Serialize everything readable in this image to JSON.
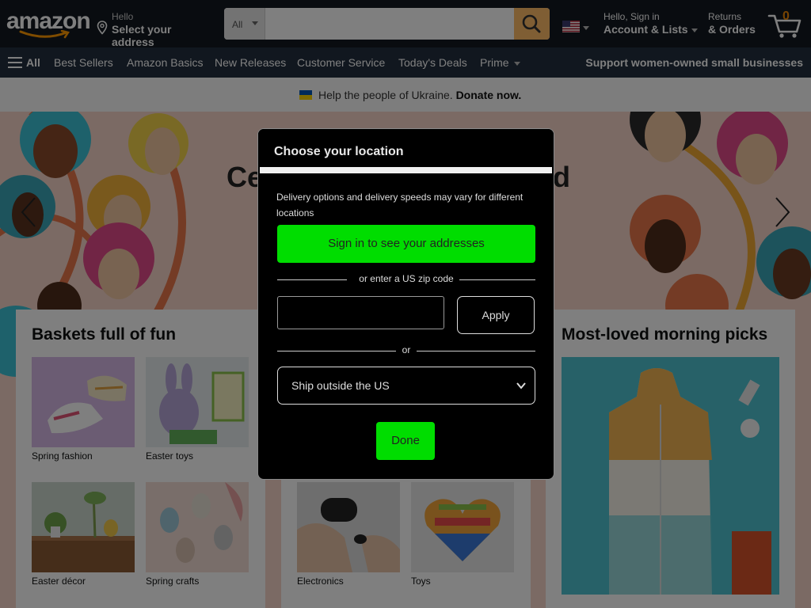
{
  "header": {
    "logo_text": "amazon",
    "address_line1": "Hello",
    "address_line2": "Select your address",
    "search_category": "All",
    "search_placeholder": "",
    "account_line1": "Hello, Sign in",
    "account_line2": "Account & Lists",
    "returns_line1": "Returns",
    "returns_line2": "& Orders",
    "cart_count": "0"
  },
  "subnav": {
    "all_label": "All",
    "items": [
      "Best Sellers",
      "Amazon Basics",
      "New Releases",
      "Customer Service",
      "Today's Deals",
      "Prime"
    ],
    "promo": "Support women-owned small businesses"
  },
  "ukraine": {
    "text": "Help the people of Ukraine.",
    "link": "Donate now."
  },
  "hero": {
    "heading_left": "Ce",
    "heading_right": "ed"
  },
  "cards": {
    "left": {
      "title": "Baskets full of fun",
      "tiles": [
        {
          "caption": "Spring fashion"
        },
        {
          "caption": "Easter toys"
        },
        {
          "caption": "Easter décor"
        },
        {
          "caption": "Spring crafts"
        }
      ]
    },
    "middle": {
      "tiles": [
        {
          "caption": "Electronics"
        },
        {
          "caption": "Toys"
        }
      ]
    },
    "right": {
      "title": "Most-loved morning picks"
    }
  },
  "modal": {
    "title": "Choose your location",
    "description": "Delivery options and delivery speeds may vary for different locations",
    "signin_label": "Sign in to see your addresses",
    "zip_divider": "or enter a US zip code",
    "zip_value": "",
    "apply_label": "Apply",
    "or_label": "or",
    "ship_outside": "Ship outside the US",
    "done_label": "Done"
  },
  "colors": {
    "header_bg": "#131921",
    "subnav_bg": "#232f3e",
    "search_button": "#febd69",
    "cart_count": "#f08804",
    "modal_button": "#00dd00",
    "modal_bg": "#000000"
  }
}
